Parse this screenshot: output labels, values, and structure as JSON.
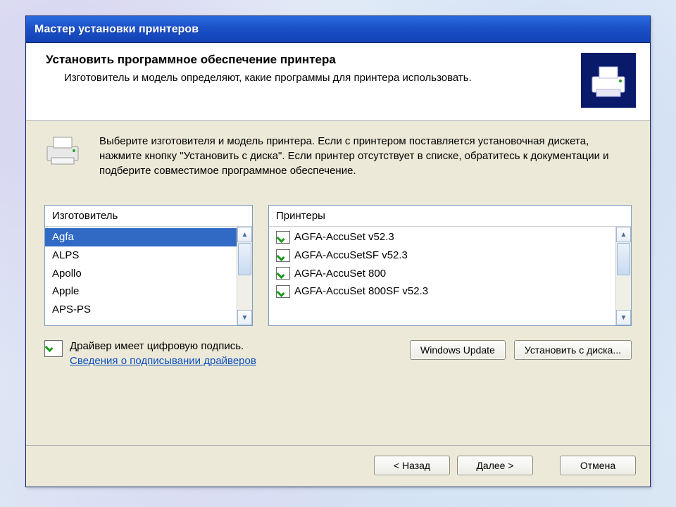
{
  "window": {
    "title": "Мастер установки принтеров"
  },
  "header": {
    "heading": "Установить программное обеспечение принтера",
    "sub": "Изготовитель и модель определяют, какие программы для принтера использовать."
  },
  "instruction": "Выберите изготовителя и модель принтера. Если с принтером поставляется установочная дискета, нажмите кнопку \"Установить с диска\". Если принтер отсутствует в списке, обратитесь к документации и подберите совместимое программное обеспечение.",
  "lists": {
    "manufacturer_header": "Изготовитель",
    "printers_header": "Принтеры",
    "manufacturers": [
      {
        "name": "Agfa",
        "selected": true
      },
      {
        "name": "ALPS"
      },
      {
        "name": "Apollo"
      },
      {
        "name": "Apple"
      },
      {
        "name": "APS-PS"
      }
    ],
    "printers": [
      {
        "name": "AGFA-AccuSet v52.3"
      },
      {
        "name": "AGFA-AccuSetSF v52.3"
      },
      {
        "name": "AGFA-AccuSet 800"
      },
      {
        "name": "AGFA-AccuSet 800SF v52.3"
      }
    ]
  },
  "signature": {
    "status": "Драйвер имеет цифровую подпись.",
    "link": "Сведения о подписывании драйверов"
  },
  "buttons": {
    "windows_update": "Windows Update",
    "install_from_disk": "Установить с диска...",
    "back": "< Назад",
    "next": "Далее >",
    "cancel": "Отмена"
  }
}
